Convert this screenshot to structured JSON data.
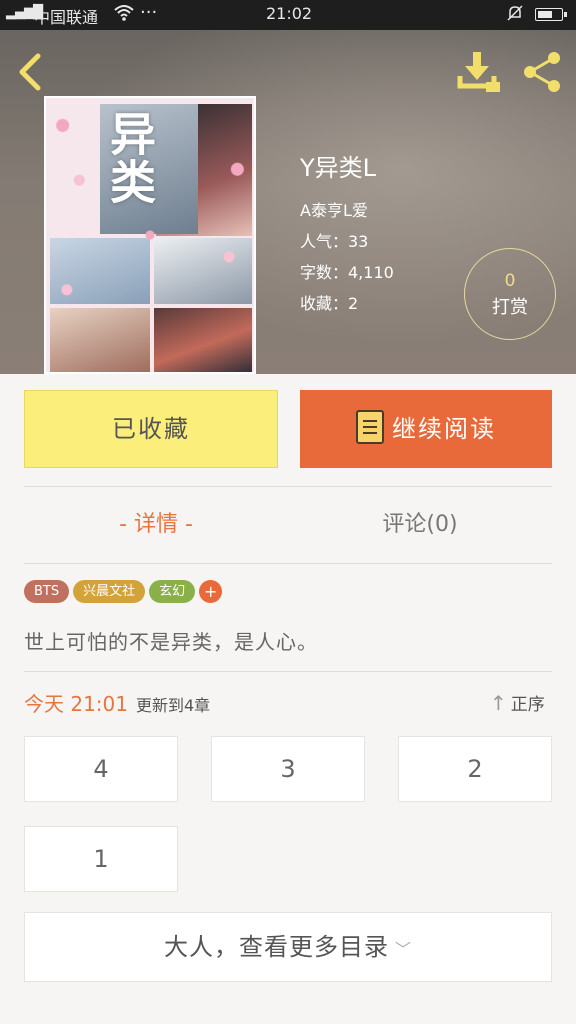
{
  "status_bar": {
    "signal": "3G",
    "carrier": "中国联通",
    "time": "21:02"
  },
  "book": {
    "title": "Y异类L",
    "author": "A泰亨L爱",
    "popularity": "人气：33",
    "word_count": "字数：4,110",
    "favorites": "收藏：2",
    "cover_text": "异类"
  },
  "tip": {
    "count": "0",
    "label": "打赏"
  },
  "actions": {
    "favorited_label": "已收藏",
    "continue_label": "继续阅读"
  },
  "tabs": {
    "detail": "- 详情 -",
    "comments": "评论(0)"
  },
  "tags": [
    {
      "label": "BTS",
      "color": "#c0705e"
    },
    {
      "label": "兴晨文社",
      "color": "#d4a23a"
    },
    {
      "label": "玄幻",
      "color": "#8ab04a"
    },
    {
      "label": "+",
      "color": "#e8693a"
    }
  ],
  "summary": "世上可怕的不是异类，是人心。",
  "update": {
    "today": "今天 21:01",
    "text": "更新到4章",
    "sort_label": "正序"
  },
  "chapters": [
    "4",
    "3",
    "2",
    "1"
  ],
  "more_label": "大人，查看更多目录",
  "colors": {
    "accent_orange": "#e8693a",
    "favorite_yellow": "#fbee7a"
  }
}
